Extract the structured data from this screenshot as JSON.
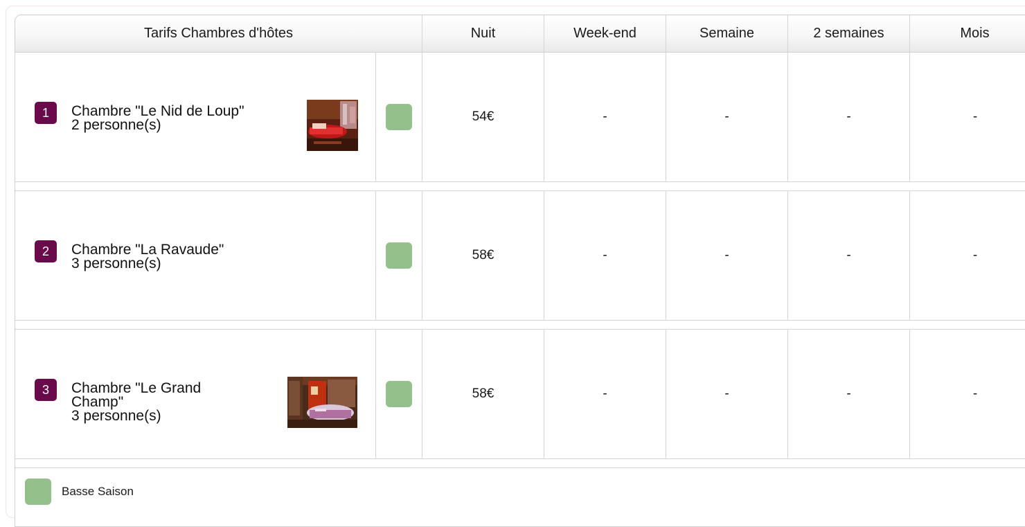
{
  "header": {
    "title": "Tarifs Chambres d'hôtes",
    "columns": [
      "Nuit",
      "Week-end",
      "Semaine",
      "2 semaines",
      "Mois"
    ]
  },
  "rooms": [
    {
      "number": "1",
      "name": "Chambre \"Le Nid de Loup\"",
      "capacity": "2 personne(s)",
      "has_photo": true,
      "season_color": "#93c08b",
      "prices": [
        "54€",
        "-",
        "-",
        "-",
        "-"
      ]
    },
    {
      "number": "2",
      "name": "Chambre \"La Ravaude\"",
      "capacity": "3 personne(s)",
      "has_photo": false,
      "season_color": "#93c08b",
      "prices": [
        "58€",
        "-",
        "-",
        "-",
        "-"
      ]
    },
    {
      "number": "3",
      "name": "Chambre \"Le Grand Champ\"",
      "capacity": "3 personne(s)",
      "has_photo": true,
      "season_color": "#93c08b",
      "prices": [
        "58€",
        "-",
        "-",
        "-",
        "-"
      ]
    }
  ],
  "legend": {
    "label": "Basse Saison",
    "color": "#93c08b"
  },
  "colors": {
    "badge": "#6b0a4a",
    "border": "#d4d4d4"
  }
}
